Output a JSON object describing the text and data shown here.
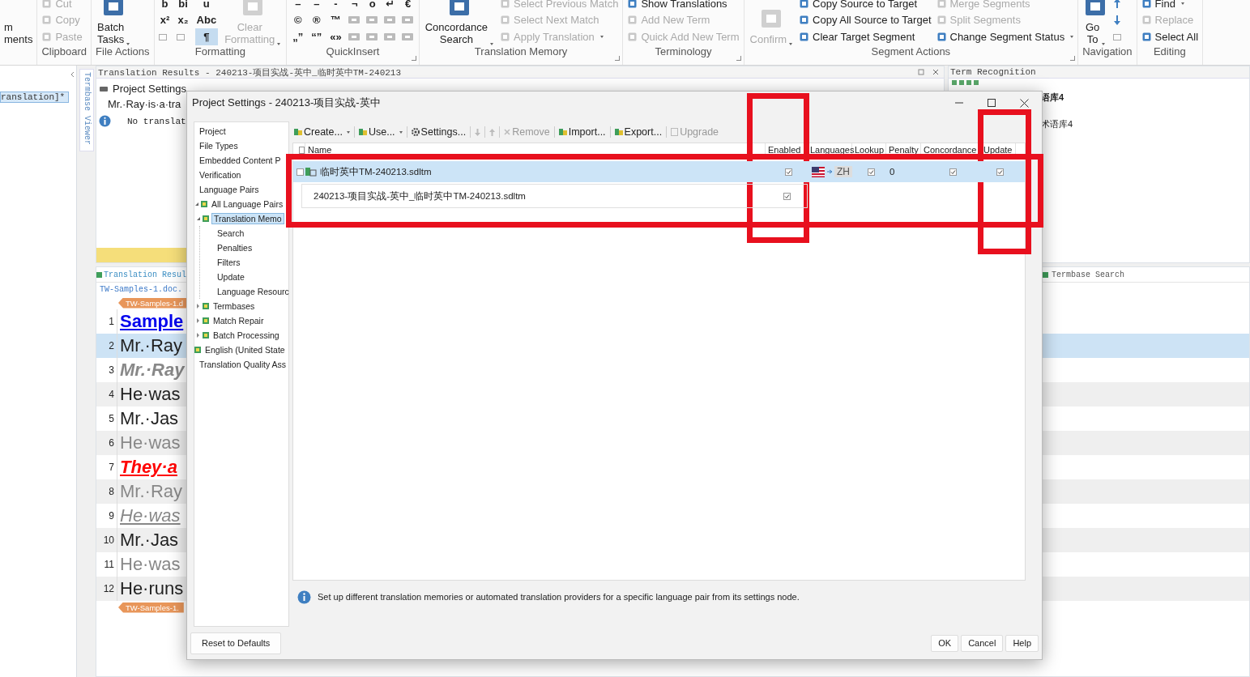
{
  "ribbon": {
    "groups": [
      {
        "columns": [
          [
            {
              "kind": "plain",
              "label": "m"
            },
            {
              "kind": "plain",
              "label": "ments"
            }
          ]
        ]
      },
      {
        "label": "Clipboard",
        "columns": [
          [
            {
              "kind": "small",
              "label": "Cut",
              "disabled": true
            },
            {
              "kind": "small",
              "label": "Copy",
              "disabled": true
            },
            {
              "kind": "small",
              "label": "Paste",
              "disabled": true
            }
          ]
        ]
      },
      {
        "label": "File Actions",
        "columns": [
          [
            {
              "kind": "big",
              "label": "Batch Tasks",
              "disabled": false,
              "dropdown": true
            }
          ]
        ]
      },
      {
        "label": "Formatting",
        "columns": [
          [
            {
              "kind": "glyph",
              "label": "b",
              "selected": false
            },
            {
              "kind": "glyph",
              "label": "x²",
              "selected": false
            },
            {
              "kind": "icon"
            }
          ],
          [
            {
              "kind": "glyph",
              "label": "bi",
              "selected": false
            },
            {
              "kind": "glyph",
              "label": "x₂",
              "selected": false
            },
            {
              "kind": "icon"
            }
          ],
          [
            {
              "kind": "glyph",
              "label": "u",
              "selected": false
            },
            {
              "kind": "glyph",
              "label": "Abc",
              "selected": false
            },
            {
              "kind": "glyph",
              "label": "¶",
              "selected": true
            }
          ],
          [
            {
              "kind": "big",
              "label": "Clear Formatting",
              "disabled": true,
              "dropdown": true
            }
          ]
        ]
      },
      {
        "label": "QuickInsert",
        "launcher": true,
        "columns": [
          [
            {
              "kind": "glyph",
              "label": "–"
            },
            {
              "kind": "glyph",
              "label": "©"
            },
            {
              "kind": "glyph",
              "label": "„”"
            }
          ],
          [
            {
              "kind": "glyph",
              "label": "–"
            },
            {
              "kind": "glyph",
              "label": "®"
            },
            {
              "kind": "glyph",
              "label": "“”"
            }
          ],
          [
            {
              "kind": "glyph",
              "label": "-"
            },
            {
              "kind": "glyph",
              "label": "™"
            },
            {
              "kind": "glyph",
              "label": "«»"
            }
          ],
          [
            {
              "kind": "glyph",
              "label": "¬"
            },
            {
              "kind": "tag"
            },
            {
              "kind": "tag"
            }
          ],
          [
            {
              "kind": "glyph",
              "label": "o"
            },
            {
              "kind": "tag"
            },
            {
              "kind": "tag"
            }
          ],
          [
            {
              "kind": "glyph",
              "label": "↵"
            },
            {
              "kind": "tag"
            },
            {
              "kind": "tag"
            }
          ],
          [
            {
              "kind": "glyph",
              "label": "€"
            },
            {
              "kind": "tag"
            },
            {
              "kind": "tag"
            }
          ]
        ]
      },
      {
        "label": "Translation Memory",
        "launcher": true,
        "columns": [
          [
            {
              "kind": "big",
              "label": "Concordance Search",
              "disabled": false,
              "dropdown": true
            }
          ],
          [
            {
              "kind": "small",
              "label": "Select Previous Match",
              "disabled": true
            },
            {
              "kind": "small",
              "label": "Select Next Match",
              "disabled": true
            },
            {
              "kind": "small",
              "label": "Apply Translation",
              "disabled": true,
              "dropdown": true
            }
          ]
        ]
      },
      {
        "label": "Terminology",
        "launcher": true,
        "columns": [
          [
            {
              "kind": "small",
              "label": "Show Translations",
              "disabled": false
            },
            {
              "kind": "small",
              "label": "Add New Term",
              "disabled": true
            },
            {
              "kind": "small",
              "label": "Quick Add New Term",
              "disabled": true
            }
          ]
        ]
      },
      {
        "label": "Segment Actions",
        "launcher": true,
        "columns": [
          [
            {
              "kind": "big",
              "label": "Confirm",
              "disabled": true,
              "dropdown": true
            }
          ],
          [
            {
              "kind": "small",
              "label": "Copy Source to Target",
              "disabled": false
            },
            {
              "kind": "small",
              "label": "Copy All Source to Target",
              "disabled": false
            },
            {
              "kind": "small",
              "label": "Clear Target Segment",
              "disabled": false
            }
          ],
          [
            {
              "kind": "small",
              "label": "Merge Segments",
              "disabled": true
            },
            {
              "kind": "small",
              "label": "Split Segments",
              "disabled": true
            },
            {
              "kind": "small",
              "label": "Change Segment Status",
              "disabled": false,
              "dropdown": true
            }
          ]
        ]
      },
      {
        "label": "Navigation",
        "columns": [
          [
            {
              "kind": "big",
              "label": "Go To",
              "disabled": false,
              "dropdown": true
            }
          ],
          [
            {
              "kind": "arrow_up"
            },
            {
              "kind": "arrow_down"
            },
            {
              "kind": "icon"
            }
          ]
        ]
      },
      {
        "label": "Editing",
        "columns": [
          [
            {
              "kind": "small",
              "label": "Find",
              "disabled": false,
              "dropdown": true
            },
            {
              "kind": "small",
              "label": "Replace",
              "disabled": true
            },
            {
              "kind": "small",
              "label": "Select All",
              "disabled": false
            }
          ]
        ]
      }
    ]
  },
  "left_panel": {
    "item": "ranslation]*"
  },
  "side_tab": {
    "label": "Termbase Viewer"
  },
  "translation_results": {
    "title": "Translation Results - 240213-项目实战-英中_临时英中TM-240213",
    "section": "Project Settings",
    "source": "Mr.·Ray·is·a·tra",
    "message": "No translat"
  },
  "term_recognition": {
    "title": "Term Recognition",
    "entries": [
      "语库4",
      "术语库4"
    ]
  },
  "editor": {
    "tab": "Translation Resul",
    "right_tab": "Termbase Search",
    "file_link": "TW-Samples-1.doc.",
    "start_tag": "TW-Samples-1.d",
    "end_tag": "TW-Samples-1.",
    "rows": [
      {
        "number": "1",
        "text": "Sample",
        "kind": "heading",
        "selected": false
      },
      {
        "number": "2",
        "text": "Mr.·Ray",
        "kind": "normal",
        "selected": true
      },
      {
        "number": "3",
        "text": "Mr.·Ray",
        "kind": "muted_bold_italic",
        "selected": false
      },
      {
        "number": "4",
        "text": "He·was",
        "kind": "normal",
        "selected": false
      },
      {
        "number": "5",
        "text": "Mr.·Jas",
        "kind": "normal",
        "selected": false
      },
      {
        "number": "6",
        "text": "He·was",
        "kind": "muted",
        "selected": false
      },
      {
        "number": "7",
        "text": "They·a",
        "kind": "emphasis",
        "selected": false
      },
      {
        "number": "8",
        "text": "Mr.·Ray",
        "kind": "muted",
        "selected": false
      },
      {
        "number": "9",
        "text": "He·was",
        "kind": "muted_italic_underline",
        "selected": false
      },
      {
        "number": "10",
        "text": "Mr.·Jas",
        "kind": "normal",
        "selected": false
      },
      {
        "number": "11",
        "text": "He·was",
        "kind": "muted",
        "selected": false
      },
      {
        "number": "12",
        "text": "He·runs",
        "kind": "normal",
        "selected": false
      }
    ]
  },
  "dialog": {
    "title": "Project Settings - 240213-项目实战-英中",
    "tree": [
      {
        "label": "Project",
        "kind": "page",
        "selected": false
      },
      {
        "label": "File Types",
        "kind": "page",
        "selected": false
      },
      {
        "label": "Embedded Content P",
        "kind": "page",
        "selected": false
      },
      {
        "label": "Verification",
        "kind": "page",
        "selected": false
      },
      {
        "label": "Language Pairs",
        "kind": "page",
        "selected": false
      },
      {
        "label": "All Language Pairs",
        "kind": "node",
        "selected": false,
        "expanded": true,
        "children": [
          {
            "label": "Translation Memo",
            "kind": "node",
            "selected": true,
            "expanded": true,
            "children": [
              {
                "label": "Search",
                "kind": "page",
                "selected": false
              },
              {
                "label": "Penalties",
                "kind": "page",
                "selected": false
              },
              {
                "label": "Filters",
                "kind": "page",
                "selected": false
              },
              {
                "label": "Update",
                "kind": "page",
                "selected": false
              },
              {
                "label": "Language Resourc",
                "kind": "page",
                "selected": false
              }
            ]
          },
          {
            "label": "Termbases",
            "kind": "node",
            "selected": false,
            "expanded": false
          },
          {
            "label": "Match Repair",
            "kind": "node",
            "selected": false,
            "expanded": false
          },
          {
            "label": "Batch Processing",
            "kind": "node",
            "selected": false,
            "expanded": false
          }
        ]
      },
      {
        "label": "English (United State",
        "kind": "node",
        "selected": false
      },
      {
        "label": "Translation Quality Ass",
        "kind": "page",
        "selected": false
      }
    ],
    "toolbar": [
      {
        "kind": "tm",
        "label": "Create...",
        "disabled": false,
        "dropdown": true
      },
      {
        "kind": "tm",
        "label": "Use...",
        "disabled": false,
        "dropdown": true
      },
      {
        "kind": "gear",
        "label": "Settings...",
        "disabled": false
      },
      {
        "kind": "arrow_down",
        "disabled": true
      },
      {
        "kind": "arrow_up",
        "disabled": true
      },
      {
        "kind": "cross",
        "label": "Remove",
        "disabled": true
      },
      {
        "kind": "tm",
        "label": "Import...",
        "disabled": false
      },
      {
        "kind": "tm",
        "label": "Export...",
        "disabled": false
      },
      {
        "kind": "doc",
        "label": "Upgrade",
        "disabled": true
      }
    ],
    "table": {
      "select_all_checked": false,
      "rows_highlighted": true,
      "columns": [
        {
          "label": "Name",
          "highlighted": false
        },
        {
          "label": "Enabled",
          "highlighted": true
        },
        {
          "label": "Languages",
          "highlighted": false
        },
        {
          "label": "Lookup",
          "highlighted": false
        },
        {
          "label": "Penalty",
          "highlighted": false
        },
        {
          "label": "Concordance",
          "highlighted": false
        },
        {
          "label": "Update",
          "highlighted": true
        }
      ],
      "rows": [
        {
          "kind": "tm",
          "selected": true,
          "checked": false,
          "name": "临时英中TM-240213.sdltm",
          "enabled": true,
          "target": "ZH",
          "lookup": true,
          "penalty": "0",
          "concordance": true,
          "update": true
        },
        {
          "kind": "project_tm",
          "selected": false,
          "name": "240213-项目实战-英中_临时英中TM-240213.sdltm",
          "enabled": true
        }
      ]
    },
    "info": "Set up different translation memories or automated translation providers for a specific language pair from its settings node.",
    "reset": "Reset to Defaults",
    "buttons": [
      "OK",
      "Cancel",
      "Help"
    ]
  }
}
